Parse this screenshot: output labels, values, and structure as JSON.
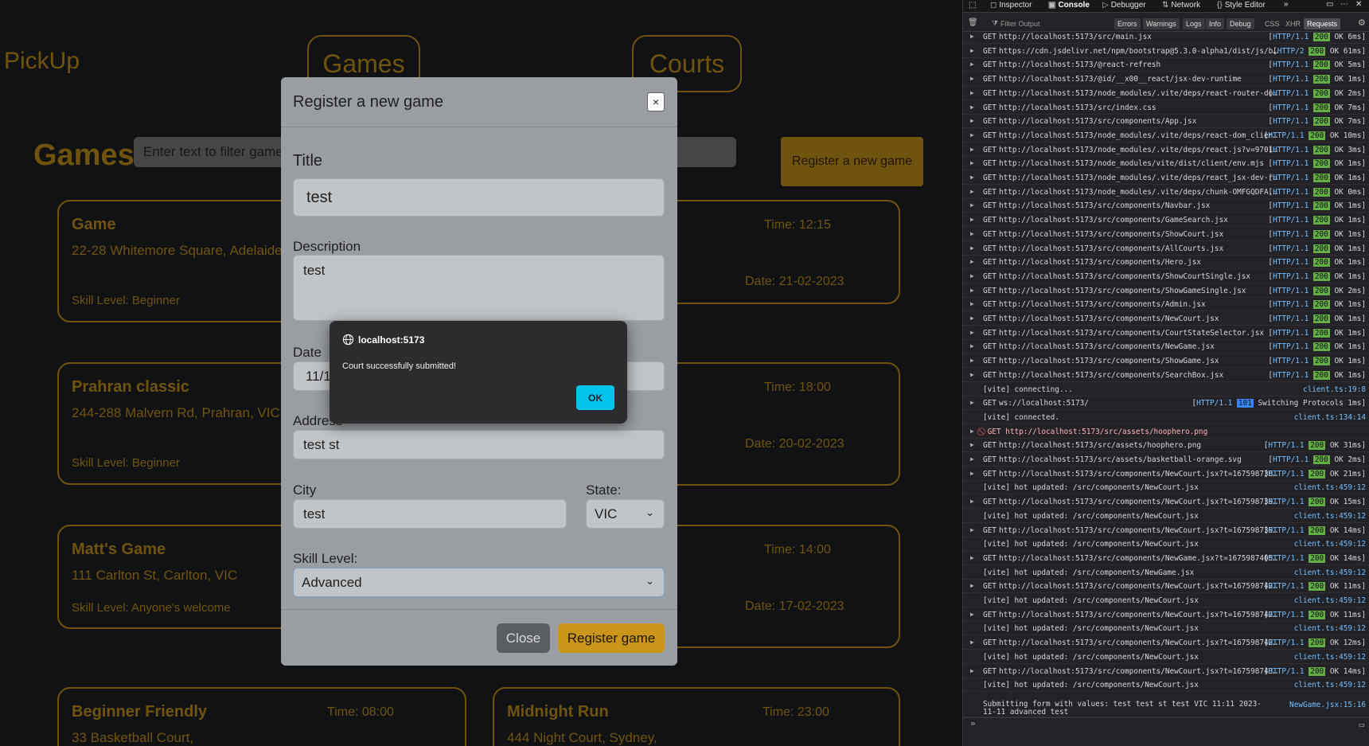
{
  "app": {
    "brand": "PickUp",
    "nav": {
      "games": "Games",
      "courts": "Courts"
    },
    "hero_title": "Games",
    "filter_placeholder": "Enter text to filter games",
    "register_button": "Register a new game",
    "games": [
      {
        "title": "Game",
        "address": "22-28 Whitemore Square, Adelaide, SA",
        "skill": "Skill Level: Beginner",
        "time": "Time: 12:15",
        "date": "Date: 21-02-2023"
      },
      {
        "title": "Prahran classic",
        "address": "244-288 Malvern Rd, Prahran, VIC",
        "skill": "Skill Level: Beginner",
        "time": "Time: 18:00",
        "date": "Date: 20-02-2023"
      },
      {
        "title": "Matt's Game",
        "address": "111 Carlton St, Carlton, VIC",
        "skill": "Skill Level: Anyone's welcome",
        "time": "Time: 14:00",
        "date": "Date: 17-02-2023"
      },
      {
        "title": "Beginner Friendly",
        "address": "33 Basketball Court,",
        "time": "Time: 08:00"
      },
      {
        "title": "Midnight Run",
        "address": "444 Night Court, Sydney,",
        "time": "Time: 23:00"
      }
    ]
  },
  "modal": {
    "title": "Register a new game",
    "close_x": "×",
    "labels": {
      "title": "Title",
      "description": "Description",
      "date": "Date",
      "address": "Address",
      "city": "City",
      "state": "State:",
      "skill": "Skill Level:"
    },
    "values": {
      "title": "test",
      "description": "test",
      "date": "11/1",
      "address": "test st",
      "city": "test",
      "state": "VIC",
      "skill": "Advanced"
    },
    "close_button": "Close",
    "submit_button": "Register game"
  },
  "alert": {
    "origin": "localhost:5173",
    "message": "Court successfully submitted!",
    "ok": "OK"
  },
  "devtools": {
    "tabs": [
      "Inspector",
      "Console",
      "Debugger",
      "Network",
      "Style Editor"
    ],
    "active_tab": "Console",
    "filter_placeholder": "Filter Output",
    "filter_chips": [
      "Errors",
      "Warnings",
      "Logs",
      "Info",
      "Debug",
      "CSS",
      "XHR",
      "Requests"
    ],
    "rows": [
      {
        "type": "get",
        "url": "http://localhost:5173/src/main.jsx",
        "proto": "HTTP/1.1",
        "code": "200",
        "rest": "OK 6ms"
      },
      {
        "type": "get",
        "url": "https://cdn.jsdelivr.net/npm/bootstrap@5.3.0-alpha1/dist/js/boot…",
        "proto": "HTTP/2",
        "code": "200",
        "rest": "OK 61ms"
      },
      {
        "type": "get",
        "url": "http://localhost:5173/@react-refresh",
        "proto": "HTTP/1.1",
        "code": "200",
        "rest": "OK 5ms"
      },
      {
        "type": "get",
        "url": "http://localhost:5173/@id/__x00__react/jsx-dev-runtime",
        "proto": "HTTP/1.1",
        "code": "200",
        "rest": "OK 1ms"
      },
      {
        "type": "get",
        "url": "http://localhost:5173/node_modules/.vite/deps/react-router-dom…",
        "proto": "HTTP/1.1",
        "code": "200",
        "rest": "OK 2ms"
      },
      {
        "type": "get",
        "url": "http://localhost:5173/src/index.css",
        "proto": "HTTP/1.1",
        "code": "200",
        "rest": "OK 7ms"
      },
      {
        "type": "get",
        "url": "http://localhost:5173/src/components/App.jsx",
        "proto": "HTTP/1.1",
        "code": "200",
        "rest": "OK 7ms"
      },
      {
        "type": "get",
        "url": "http://localhost:5173/node_modules/.vite/deps/react-dom_client…",
        "proto": "HTTP/1.1",
        "code": "200",
        "rest": "OK 10ms"
      },
      {
        "type": "get",
        "url": "http://localhost:5173/node_modules/.vite/deps/react.js?v=970141…",
        "proto": "HTTP/1.1",
        "code": "200",
        "rest": "OK 3ms"
      },
      {
        "type": "get",
        "url": "http://localhost:5173/node_modules/vite/dist/client/env.mjs",
        "proto": "HTTP/1.1",
        "code": "200",
        "rest": "OK 1ms"
      },
      {
        "type": "get",
        "url": "http://localhost:5173/node_modules/.vite/deps/react_jsx-dev-run…",
        "proto": "HTTP/1.1",
        "code": "200",
        "rest": "OK 1ms"
      },
      {
        "type": "get",
        "url": "http://localhost:5173/node_modules/.vite/deps/chunk-OMFGQDFA.js…",
        "proto": "HTTP/1.1",
        "code": "200",
        "rest": "OK 0ms"
      },
      {
        "type": "get",
        "url": "http://localhost:5173/src/components/Navbar.jsx",
        "proto": "HTTP/1.1",
        "code": "200",
        "rest": "OK 1ms"
      },
      {
        "type": "get",
        "url": "http://localhost:5173/src/components/GameSearch.jsx",
        "proto": "HTTP/1.1",
        "code": "200",
        "rest": "OK 1ms"
      },
      {
        "type": "get",
        "url": "http://localhost:5173/src/components/ShowCourt.jsx",
        "proto": "HTTP/1.1",
        "code": "200",
        "rest": "OK 1ms"
      },
      {
        "type": "get",
        "url": "http://localhost:5173/src/components/AllCourts.jsx",
        "proto": "HTTP/1.1",
        "code": "200",
        "rest": "OK 1ms"
      },
      {
        "type": "get",
        "url": "http://localhost:5173/src/components/Hero.jsx",
        "proto": "HTTP/1.1",
        "code": "200",
        "rest": "OK 1ms"
      },
      {
        "type": "get",
        "url": "http://localhost:5173/src/components/ShowCourtSingle.jsx",
        "proto": "HTTP/1.1",
        "code": "200",
        "rest": "OK 1ms"
      },
      {
        "type": "get",
        "url": "http://localhost:5173/src/components/ShowGameSingle.jsx",
        "proto": "HTTP/1.1",
        "code": "200",
        "rest": "OK 2ms"
      },
      {
        "type": "get",
        "url": "http://localhost:5173/src/components/Admin.jsx",
        "proto": "HTTP/1.1",
        "code": "200",
        "rest": "OK 1ms"
      },
      {
        "type": "get",
        "url": "http://localhost:5173/src/components/NewCourt.jsx",
        "proto": "HTTP/1.1",
        "code": "200",
        "rest": "OK 1ms"
      },
      {
        "type": "get",
        "url": "http://localhost:5173/src/components/CourtStateSelector.jsx",
        "proto": "HTTP/1.1",
        "code": "200",
        "rest": "OK 1ms"
      },
      {
        "type": "get",
        "url": "http://localhost:5173/src/components/NewGame.jsx",
        "proto": "HTTP/1.1",
        "code": "200",
        "rest": "OK 1ms"
      },
      {
        "type": "get",
        "url": "http://localhost:5173/src/components/ShowGame.jsx",
        "proto": "HTTP/1.1",
        "code": "200",
        "rest": "OK 1ms"
      },
      {
        "type": "get",
        "url": "http://localhost:5173/src/components/SearchBox.jsx",
        "proto": "HTTP/1.1",
        "code": "200",
        "rest": "OK 1ms"
      },
      {
        "type": "log",
        "text": "[vite] connecting...",
        "src": "client.ts:19:8"
      },
      {
        "type": "get",
        "url": "ws://localhost:5173/",
        "proto": "HTTP/1.1",
        "code": "101",
        "rest": "Switching Protocols 1ms",
        "ws": true
      },
      {
        "type": "log",
        "text": "[vite] connected.",
        "src": "client.ts:134:14"
      },
      {
        "type": "err",
        "url": "GET http://localhost:5173/src/assets/hoophero.png"
      },
      {
        "type": "get",
        "url": "http://localhost:5173/src/assets/hoophero.png",
        "proto": "HTTP/1.1",
        "code": "200",
        "rest": "OK 31ms"
      },
      {
        "type": "get",
        "url": "http://localhost:5173/src/assets/basketball-orange.svg",
        "proto": "HTTP/1.1",
        "code": "200",
        "rest": "OK 2ms"
      },
      {
        "type": "get",
        "url": "http://localhost:5173/src/components/NewCourt.jsx?t=1675987386…",
        "proto": "HTTP/1.1",
        "code": "200",
        "rest": "OK 21ms"
      },
      {
        "type": "log",
        "text": "[vite] hot updated: /src/components/NewCourt.jsx",
        "src": "client.ts:459:12"
      },
      {
        "type": "get",
        "url": "http://localhost:5173/src/components/NewCourt.jsx?t=1675987390…",
        "proto": "HTTP/1.1",
        "code": "200",
        "rest": "OK 15ms"
      },
      {
        "type": "log",
        "text": "[vite] hot updated: /src/components/NewCourt.jsx",
        "src": "client.ts:459:12"
      },
      {
        "type": "get",
        "url": "http://localhost:5173/src/components/NewCourt.jsx?t=1675987391…",
        "proto": "HTTP/1.1",
        "code": "200",
        "rest": "OK 14ms"
      },
      {
        "type": "log",
        "text": "[vite] hot updated: /src/components/NewCourt.jsx",
        "src": "client.ts:459:12"
      },
      {
        "type": "get",
        "url": "http://localhost:5173/src/components/NewGame.jsx?t=16759874050…",
        "proto": "HTTP/1.1",
        "code": "200",
        "rest": "OK 14ms"
      },
      {
        "type": "log",
        "text": "[vite] hot updated: /src/components/NewGame.jsx",
        "src": "client.ts:459:12"
      },
      {
        "type": "get",
        "url": "http://localhost:5173/src/components/NewCourt.jsx?t=1675987426…",
        "proto": "HTTP/1.1",
        "code": "200",
        "rest": "OK 11ms"
      },
      {
        "type": "log",
        "text": "[vite] hot updated: /src/components/NewCourt.jsx",
        "src": "client.ts:459:12"
      },
      {
        "type": "get",
        "url": "http://localhost:5173/src/components/NewCourt.jsx?t=1675987429…",
        "proto": "HTTP/1.1",
        "code": "200",
        "rest": "OK 11ms"
      },
      {
        "type": "log",
        "text": "[vite] hot updated: /src/components/NewCourt.jsx",
        "src": "client.ts:459:12"
      },
      {
        "type": "get",
        "url": "http://localhost:5173/src/components/NewCourt.jsx?t=1675987429…",
        "proto": "HTTP/1.1",
        "code": "200",
        "rest": "OK 12ms"
      },
      {
        "type": "log",
        "text": "[vite] hot updated: /src/components/NewCourt.jsx",
        "src": "client.ts:459:12"
      },
      {
        "type": "get",
        "url": "http://localhost:5173/src/components/NewCourt.jsx?t=1675987432…",
        "proto": "HTTP/1.1",
        "code": "200",
        "rest": "OK 14ms"
      },
      {
        "type": "log",
        "text": "[vite] hot updated: /src/components/NewCourt.jsx",
        "src": "client.ts:459:12"
      }
    ],
    "last_log": "Submitting form with values: test test st test VIC 11:11 2023-11-11 advanced test",
    "last_log_src": "NewGame.jsx:15:16",
    "prompt": "»"
  },
  "colors": {
    "accent": "#e0a81c",
    "modal_bg": "#9a9ea2",
    "ok_button": "#00c4ec",
    "status_ok": "#62ad45"
  }
}
